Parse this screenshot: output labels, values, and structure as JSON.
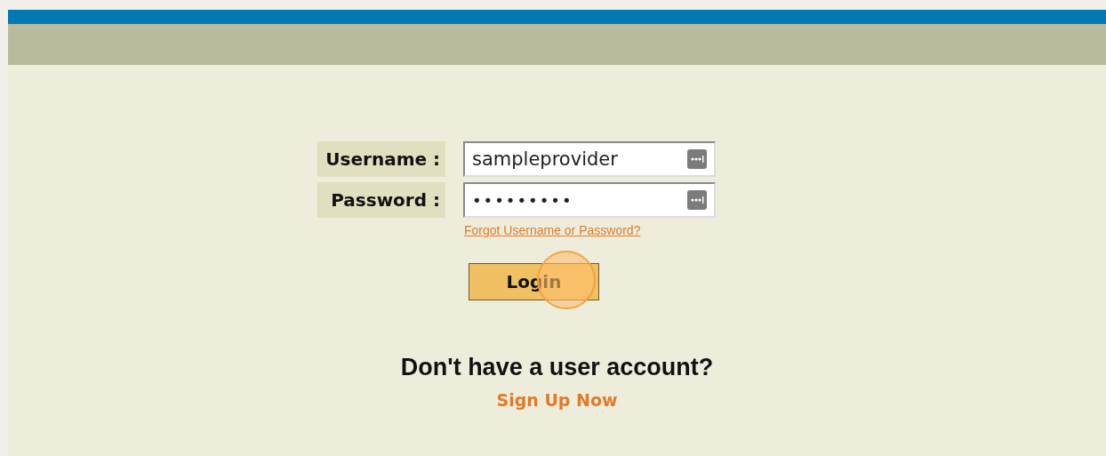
{
  "form": {
    "fields": [
      {
        "label": "Username :",
        "value": "sampleprovider"
      },
      {
        "label": "Password :",
        "value": "•••••••••"
      }
    ],
    "forgot_link": "Forgot Username or Password?",
    "login_button": "Login"
  },
  "signup": {
    "heading": "Don't have a user account?",
    "link": "Sign Up Now"
  }
}
